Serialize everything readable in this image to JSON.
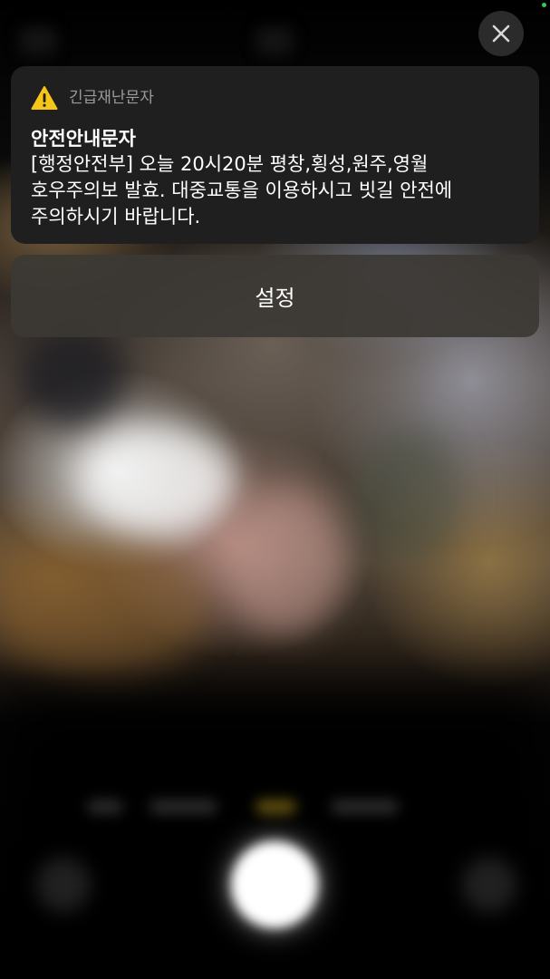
{
  "status": {
    "privacy_indicator_color": "#34c759"
  },
  "close_button": {
    "icon": "close-icon"
  },
  "alert": {
    "icon": "warning-triangle-icon",
    "icon_color": "#f5c518",
    "category": "긴급재난문자",
    "title": "안전안내문자",
    "body": "[행정안전부] 오늘 20시20분 평창,횡성,원주,영월 호우주의보 발효. 대중교통을 이용하시고 빗길 안전에 주의하시기 바랍니다."
  },
  "settings_button": {
    "label": "설정"
  }
}
